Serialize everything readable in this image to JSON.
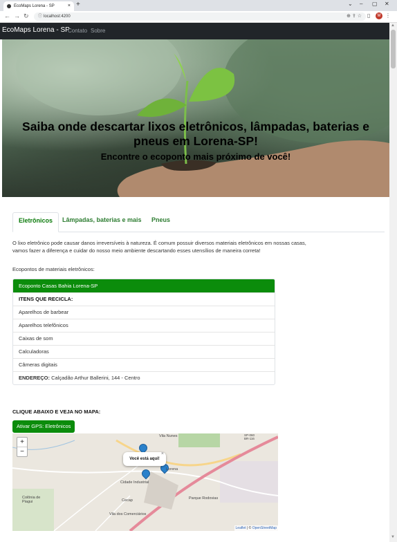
{
  "browser": {
    "tab_title": "EcoMaps Lorena - SP",
    "tab_close": "×",
    "new_tab": "+",
    "url": "localhost:4200",
    "profile_initial": "M",
    "window_controls": [
      "⌄",
      "–",
      "▢",
      "✕"
    ]
  },
  "navbar": {
    "brand": "EcoMaps Lorena - SP",
    "links": [
      "Contato",
      "Sobre"
    ]
  },
  "hero": {
    "title": "Saiba onde descartar lixos eletrônicos, lâmpadas, baterias e pneus em Lorena-SP!",
    "subtitle": "Encontre o ecoponto mais próximo de você!"
  },
  "tabs": [
    {
      "label": "Eletrônicos",
      "active": true
    },
    {
      "label": "Lâmpadas, baterias e mais",
      "active": false
    },
    {
      "label": "Pneus",
      "active": false
    }
  ],
  "content": {
    "description": "O lixo eletrônico pode causar danos irreversíveis à natureza. É comum possuir diversos materiais eletrônicos em nossas casas, vamos fazer a diferença e cuidar do nosso meio ambiente descartando esses utensílios de maneira correta!",
    "ecopoints_heading": "Ecopontos de materiais eletrônicos:",
    "ecopoint": {
      "name": "Ecoponto Casas Bahia Lorena-SP",
      "items_heading": "ITENS QUE RECICLA:",
      "items": [
        "Aparelhos de barbear",
        "Aparelhos telefônicos",
        "Caixas de som",
        "Calculadoras",
        "Câmeras digitais"
      ],
      "address_label": "ENDEREÇO:",
      "address": "Calçadão Arthur Ballerini, 144 - Centro"
    },
    "map_heading": "CLIQUE ABAIXO E VEJA NO MAPA:",
    "gps_button": "Ativar GPS: Eletrônicos"
  },
  "map": {
    "zoom_in": "+",
    "zoom_out": "−",
    "popup": "Você está aqui!",
    "popup_close": "×",
    "labels": {
      "vila_nunes": "Vila Nunes",
      "lorena": "Lorena",
      "cidade_industrial": "Cidade Industrial",
      "colonia": "Colônia de\nPiagui",
      "cecap": "Cecap",
      "parque_rodovias": "Parque Rodovias",
      "vila_comerciarios": "Vila dos Comerciários",
      "highway": "SP-060\nBR-116"
    },
    "attribution": {
      "leaflet": "Leaflet",
      "sep": " | © ",
      "osm": "OpenStreetMap"
    }
  },
  "colors": {
    "primary_green": "#0b8c0b",
    "navbar_bg": "#212529"
  }
}
